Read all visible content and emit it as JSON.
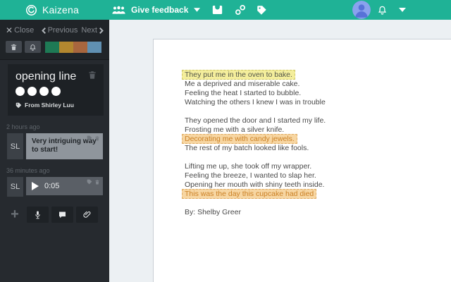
{
  "colors": {
    "brand_teal": "#1fb296",
    "sidebar_bg": "#262a2f",
    "swatch_green": "#1e7a55",
    "swatch_gold": "#b3872f",
    "swatch_rust": "#a8663e",
    "swatch_blue": "#6090b2",
    "highlight_yellow_bg": "#f4ee9c",
    "highlight_orange_bg": "#f7d6a2",
    "highlight_orange_text": "#cb8126",
    "avatar_blue": "#8aa2ee"
  },
  "header": {
    "brand": "Kaizena",
    "give_feedback": "Give feedback"
  },
  "sidebar": {
    "close": "Close",
    "previous": "Previous",
    "next": "Next",
    "card": {
      "title": "opening line",
      "rating_dots": 4,
      "from": "From Shirley Luu"
    },
    "comments": [
      {
        "time": "2 hours ago",
        "initials": "SL",
        "text": "Very intriguing way to start!"
      },
      {
        "time": "36 minutes ago",
        "initials": "SL",
        "audio_duration": "0:05"
      }
    ]
  },
  "document": {
    "stanzas": [
      {
        "lines": [
          {
            "text": "They put me in the oven to bake.",
            "highlight": "yellow"
          },
          {
            "text": "Me a deprived and miserable cake."
          },
          {
            "text": "Feeling the heat I started to bubble."
          },
          {
            "text": "Watching the others I knew I was in trouble"
          }
        ]
      },
      {
        "lines": [
          {
            "text": "They opened the door and I started my life."
          },
          {
            "text": "Frosting me with a silver knife."
          },
          {
            "text": "Decorating me with candy jewels.",
            "highlight": "orange"
          },
          {
            "text": "The rest of my batch looked like fools."
          }
        ]
      },
      {
        "lines": [
          {
            "text": "Lifting me up, she took off my wrapper."
          },
          {
            "text": "Feeling the breeze, I wanted to slap her."
          },
          {
            "text": "Opening her mouth with shiny teeth inside."
          },
          {
            "text": "This was the day this cupcake had died",
            "highlight": "orange"
          }
        ]
      }
    ],
    "byline": "By: Shelby Greer"
  }
}
